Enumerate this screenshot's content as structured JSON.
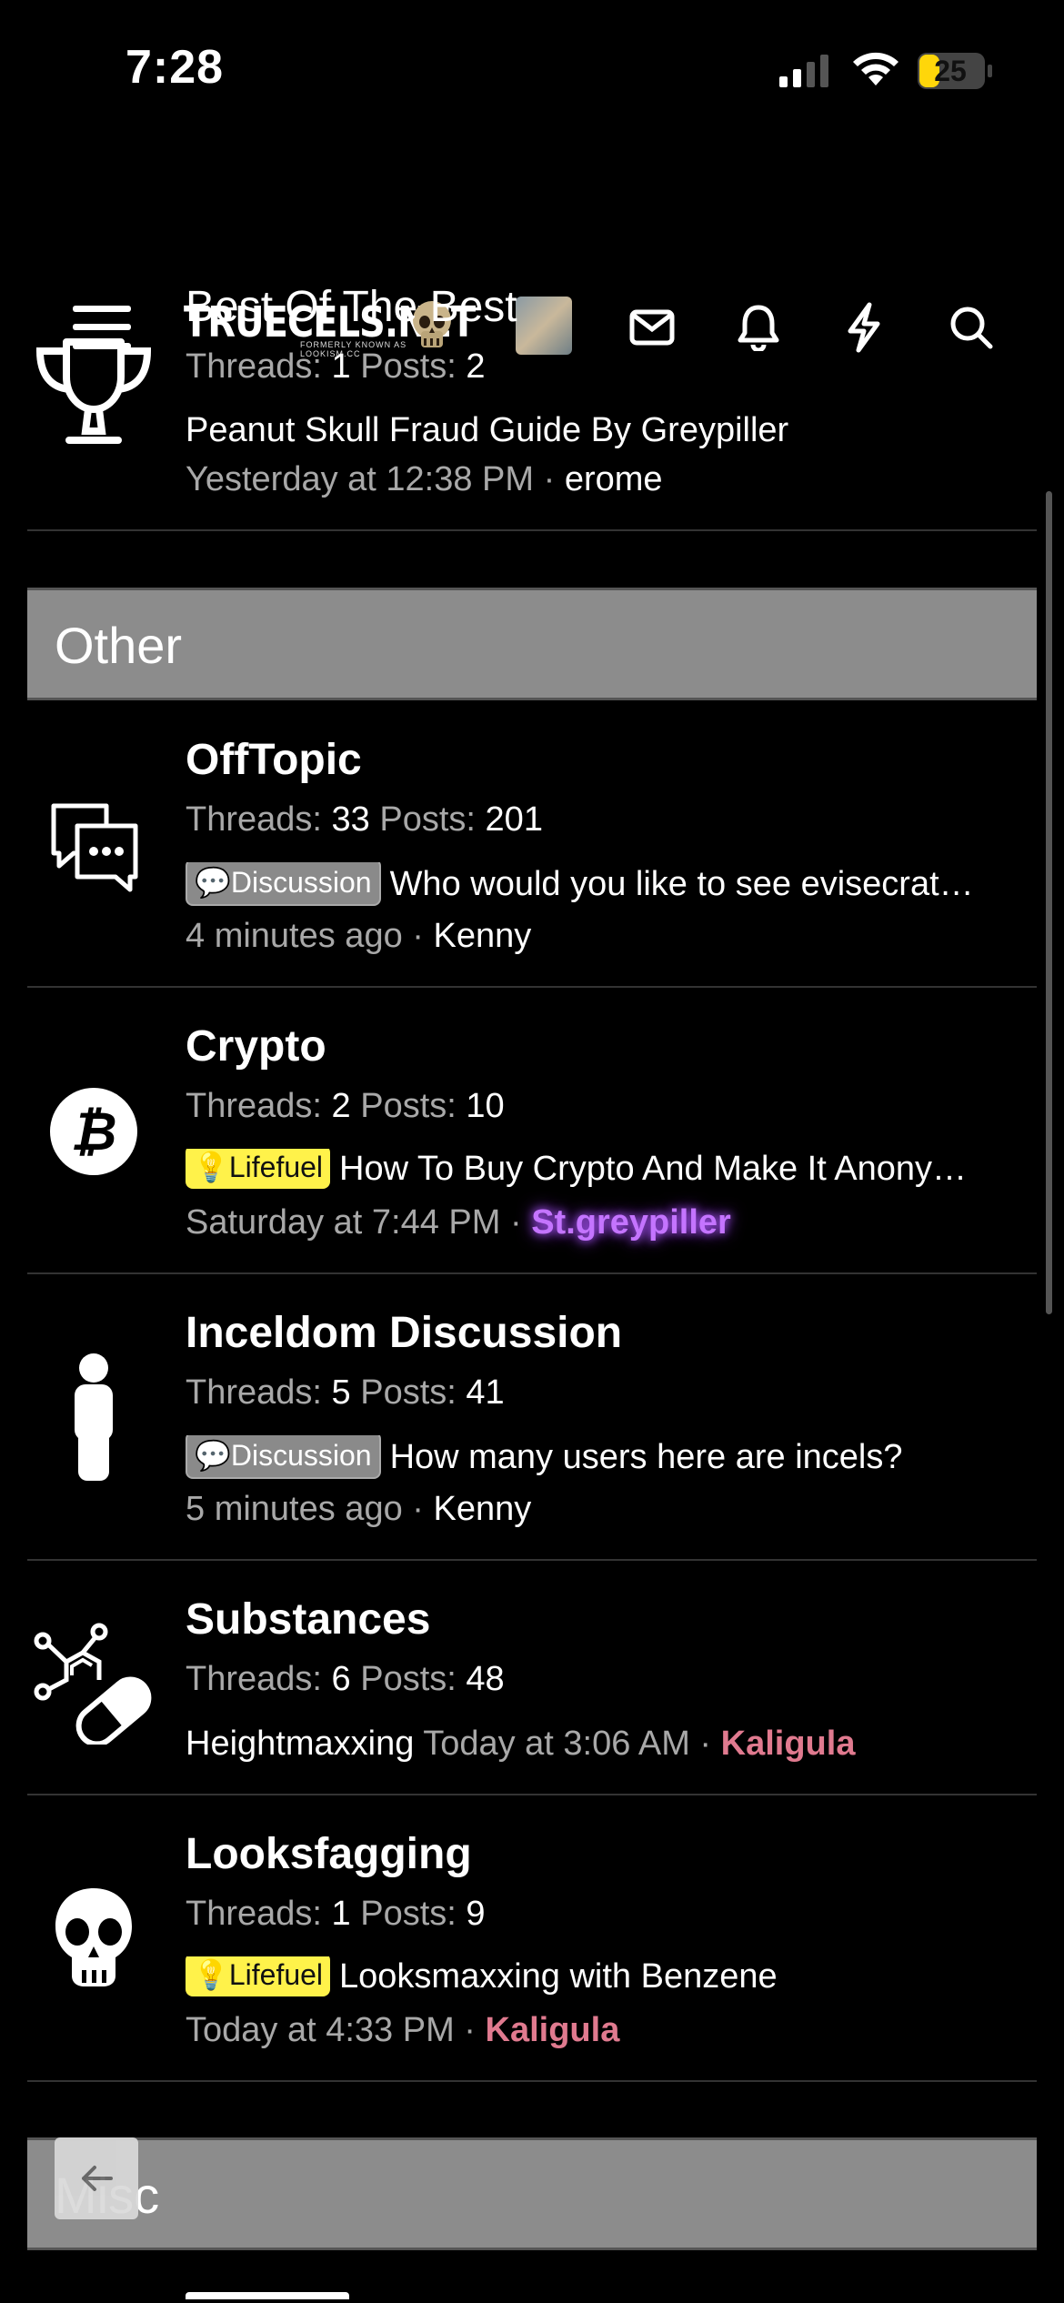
{
  "status": {
    "time": "7:28",
    "battery": "25"
  },
  "header": {
    "logo_text": "TRUECELS.NET",
    "logo_sub": "FORMERLY KNOWN AS LOOKISM.CC",
    "icons": [
      "menu-icon",
      "skull-icon",
      "avatar",
      "mail-icon",
      "bell-icon",
      "lightning-icon",
      "search-icon"
    ]
  },
  "forums_top": [
    {
      "title": "Best Of The Best",
      "icon": "trophy-icon",
      "threads_label": "Threads:",
      "threads": "1",
      "posts_label": "Posts:",
      "posts": "2",
      "latest": "Peanut Skull Fraud Guide By Greypiller",
      "time": "Yesterday at 12:38 PM",
      "user": "erome"
    }
  ],
  "categories": [
    {
      "label": "Other"
    },
    {
      "label": "Misc"
    }
  ],
  "forums_other": [
    {
      "title": "OffTopic",
      "icon": "chat-bubbles-icon",
      "threads_label": "Threads:",
      "threads": "33",
      "posts_label": "Posts:",
      "posts": "201",
      "prefix": "Discussion",
      "latest": "Who would you like to see evisecrat…",
      "time": "4 minutes ago",
      "user": "Kenny"
    },
    {
      "title": "Crypto",
      "icon": "bitcoin-icon",
      "threads_label": "Threads:",
      "threads": "2",
      "posts_label": "Posts:",
      "posts": "10",
      "prefix": "Lifefuel",
      "latest": "How To Buy Crypto And Make It Anony…",
      "time": "Saturday at 7:44 PM",
      "user": "St.greypiller"
    },
    {
      "title": "Inceldom Discussion",
      "icon": "person-icon",
      "threads_label": "Threads:",
      "threads": "5",
      "posts_label": "Posts:",
      "posts": "41",
      "prefix": "Discussion",
      "latest": "How many users here are incels?",
      "time": "5 minutes ago",
      "user": "Kenny"
    },
    {
      "title": "Substances",
      "icon": "molecule-pill-icon",
      "threads_label": "Threads:",
      "threads": "6",
      "posts_label": "Posts:",
      "posts": "48",
      "latest": "Heightmaxxing",
      "time": "Today at 3:06 AM",
      "user": "Kaligula"
    },
    {
      "title": "Looksfagging",
      "icon": "skull-icon",
      "threads_label": "Threads:",
      "threads": "1",
      "posts_label": "Posts:",
      "posts": "9",
      "prefix": "Lifefuel",
      "latest": "Looksmaxxing with Benzene",
      "time": "Today at 4:33 PM",
      "user": "Kaligula"
    }
  ],
  "sep": "·",
  "colors": {
    "category_bg": "#8c8c8c",
    "pink_user": "#e07a8f",
    "purple_user": "#c474ff",
    "lifefuel": "#fff24a"
  }
}
